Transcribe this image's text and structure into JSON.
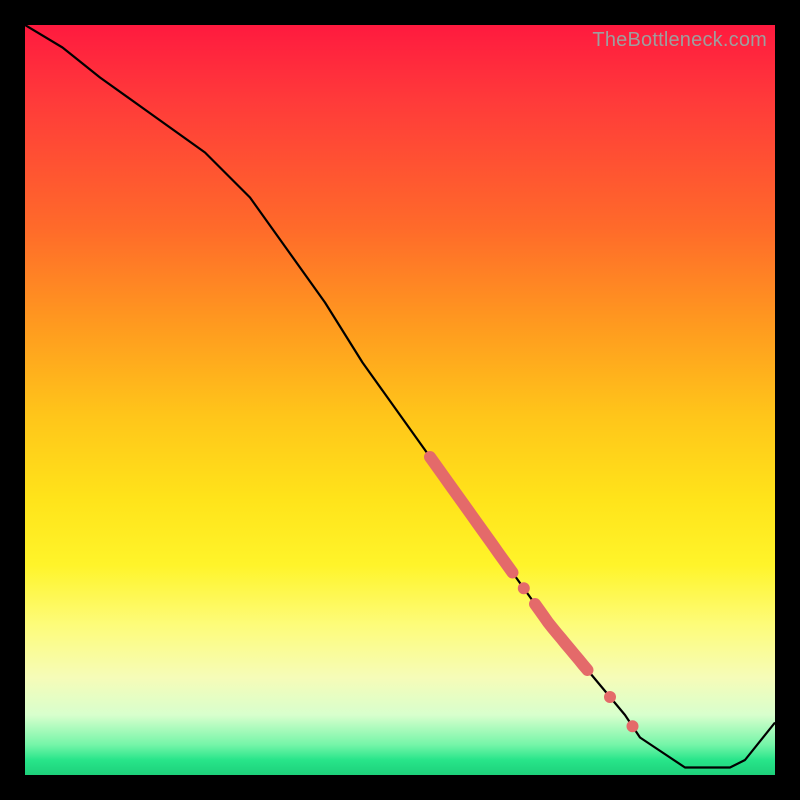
{
  "watermark": "TheBottleneck.com",
  "colors": {
    "gradient_top": "#ff1a3f",
    "gradient_mid": "#ffe31a",
    "gradient_bottom": "#28e58a",
    "curve": "#000000",
    "highlight": "#e46a6a",
    "frame": "#000000"
  },
  "chart_data": {
    "type": "line",
    "title": "",
    "xlabel": "",
    "ylabel": "",
    "xlim": [
      0,
      100
    ],
    "ylim": [
      0,
      100
    ],
    "x": [
      0,
      5,
      10,
      17,
      24,
      30,
      35,
      40,
      45,
      50,
      55,
      60,
      65,
      70,
      75,
      80,
      82,
      85,
      88,
      91,
      94,
      96,
      100
    ],
    "values": [
      100,
      97,
      93,
      88,
      83,
      77,
      70,
      63,
      55,
      48,
      41,
      34,
      27,
      20,
      14,
      8,
      5,
      3,
      1,
      1,
      1,
      2,
      7
    ],
    "highlight_segments": [
      {
        "x0": 54,
        "x1": 65
      },
      {
        "x0": 68,
        "x1": 75
      }
    ],
    "highlight_points": [
      66.5,
      78,
      81
    ],
    "annotations": []
  }
}
